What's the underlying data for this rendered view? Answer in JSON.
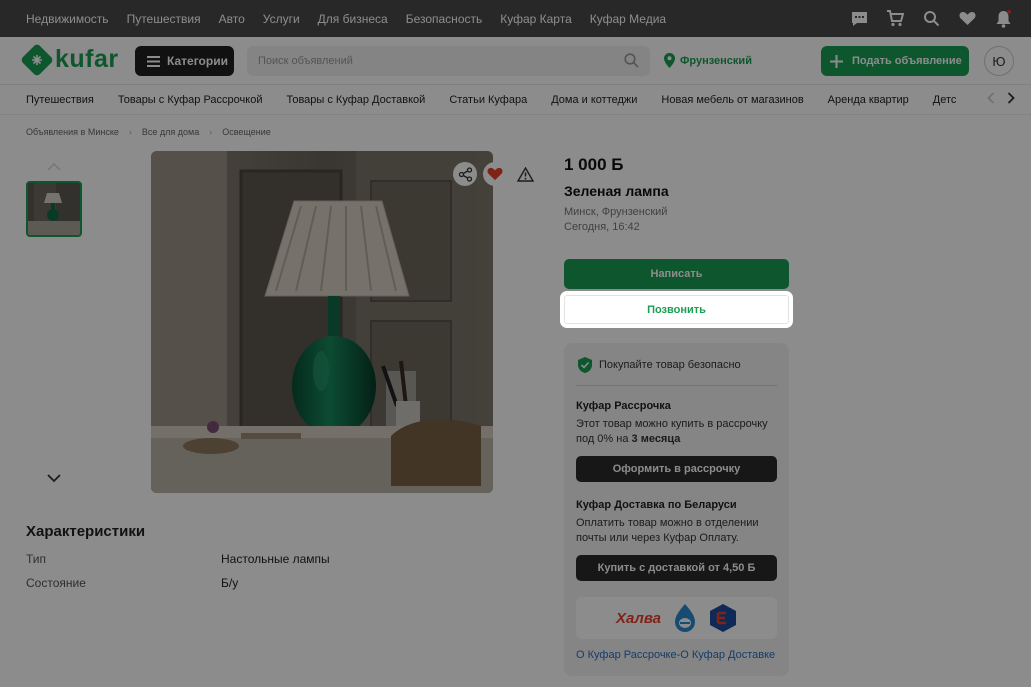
{
  "topnav": {
    "links": [
      "Недвижимость",
      "Путешествия",
      "Авто",
      "Услуги",
      "Для бизнеса",
      "Безопасность",
      "Куфар Карта",
      "Куфар Медиа"
    ],
    "icons": [
      "chat-icon",
      "cart-icon",
      "search-favorites-icon",
      "heart-icon",
      "bell-icon"
    ]
  },
  "header": {
    "logo_text": "kufar",
    "categories_label": "Категории",
    "search_placeholder": "Поиск объявлений",
    "location": "Фрунзенский",
    "post_label": "Подать объявление",
    "avatar_letter": "Ю"
  },
  "catbar": {
    "items": [
      "Путешествия",
      "Товары с Куфар Рассрочкой",
      "Товары с Куфар Доставкой",
      "Статьи Куфара",
      "Дома и коттеджи",
      "Новая мебель от магазинов",
      "Аренда квартир",
      "Детс"
    ]
  },
  "breadcrumbs": [
    "Объявления в Минске",
    "Все для дома",
    "Освещение"
  ],
  "listing": {
    "price": "1 000 Б",
    "title": "Зеленая лампа",
    "location": "Минск, Фрунзенский",
    "date": "Сегодня, 16:42",
    "write_label": "Написать",
    "call_label": "Позвонить"
  },
  "characteristics": {
    "title": "Характеристики",
    "rows": [
      {
        "label": "Тип",
        "value": "Настольные лампы"
      },
      {
        "label": "Состояние",
        "value": "Б/у"
      }
    ]
  },
  "safe": {
    "header": "Покупайте товар безопасно",
    "installment_title": "Куфар Рассрочка",
    "installment_text": "Этот товар можно купить в рассрочку под 0% на",
    "installment_bold": "3 месяца",
    "installment_btn": "Оформить в рассрочку",
    "delivery_title": "Куфар Доставка по Беларуси",
    "delivery_text": "Оплатить товар можно в отделении почты или через Куфар Оплату.",
    "delivery_btn": "Купить с доставкой от 4,50 Б",
    "halva": "Халва",
    "links": "О Куфар Рассрочке-О Куфар Доставке"
  },
  "colors": {
    "accent": "#1a9e54",
    "dark": "#2a2a2a"
  }
}
